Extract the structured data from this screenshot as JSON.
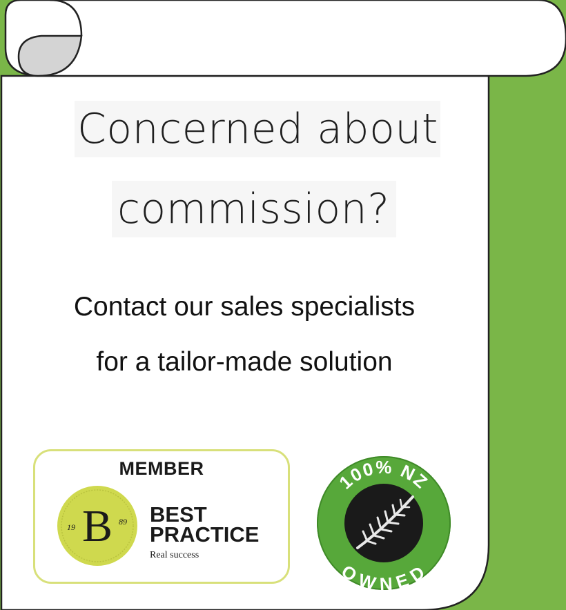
{
  "headline": {
    "line1": "Concerned about",
    "line2": "commission?"
  },
  "body": {
    "line1": "Contact our sales specialists",
    "line2": "for a tailor-made solution"
  },
  "member_badge": {
    "label": "MEMBER",
    "seal_letter": "B",
    "seal_year_left": "19",
    "seal_year_right": "89",
    "title_line1": "BEST",
    "title_line2": "PRACTICE",
    "subtitle": "Real success"
  },
  "nz_badge": {
    "top_text": "100% NZ",
    "bottom_text": "OWNED",
    "icon": "silver-fern-icon"
  },
  "colors": {
    "green_background": "#7ab648",
    "scroll_fill": "#ffffff",
    "scroll_curl": "#d4d4d4",
    "member_border": "#d8e07a",
    "seal_fill": "#cfd94e",
    "nz_ring": "#57a83a",
    "nz_center": "#1a1a1a"
  }
}
